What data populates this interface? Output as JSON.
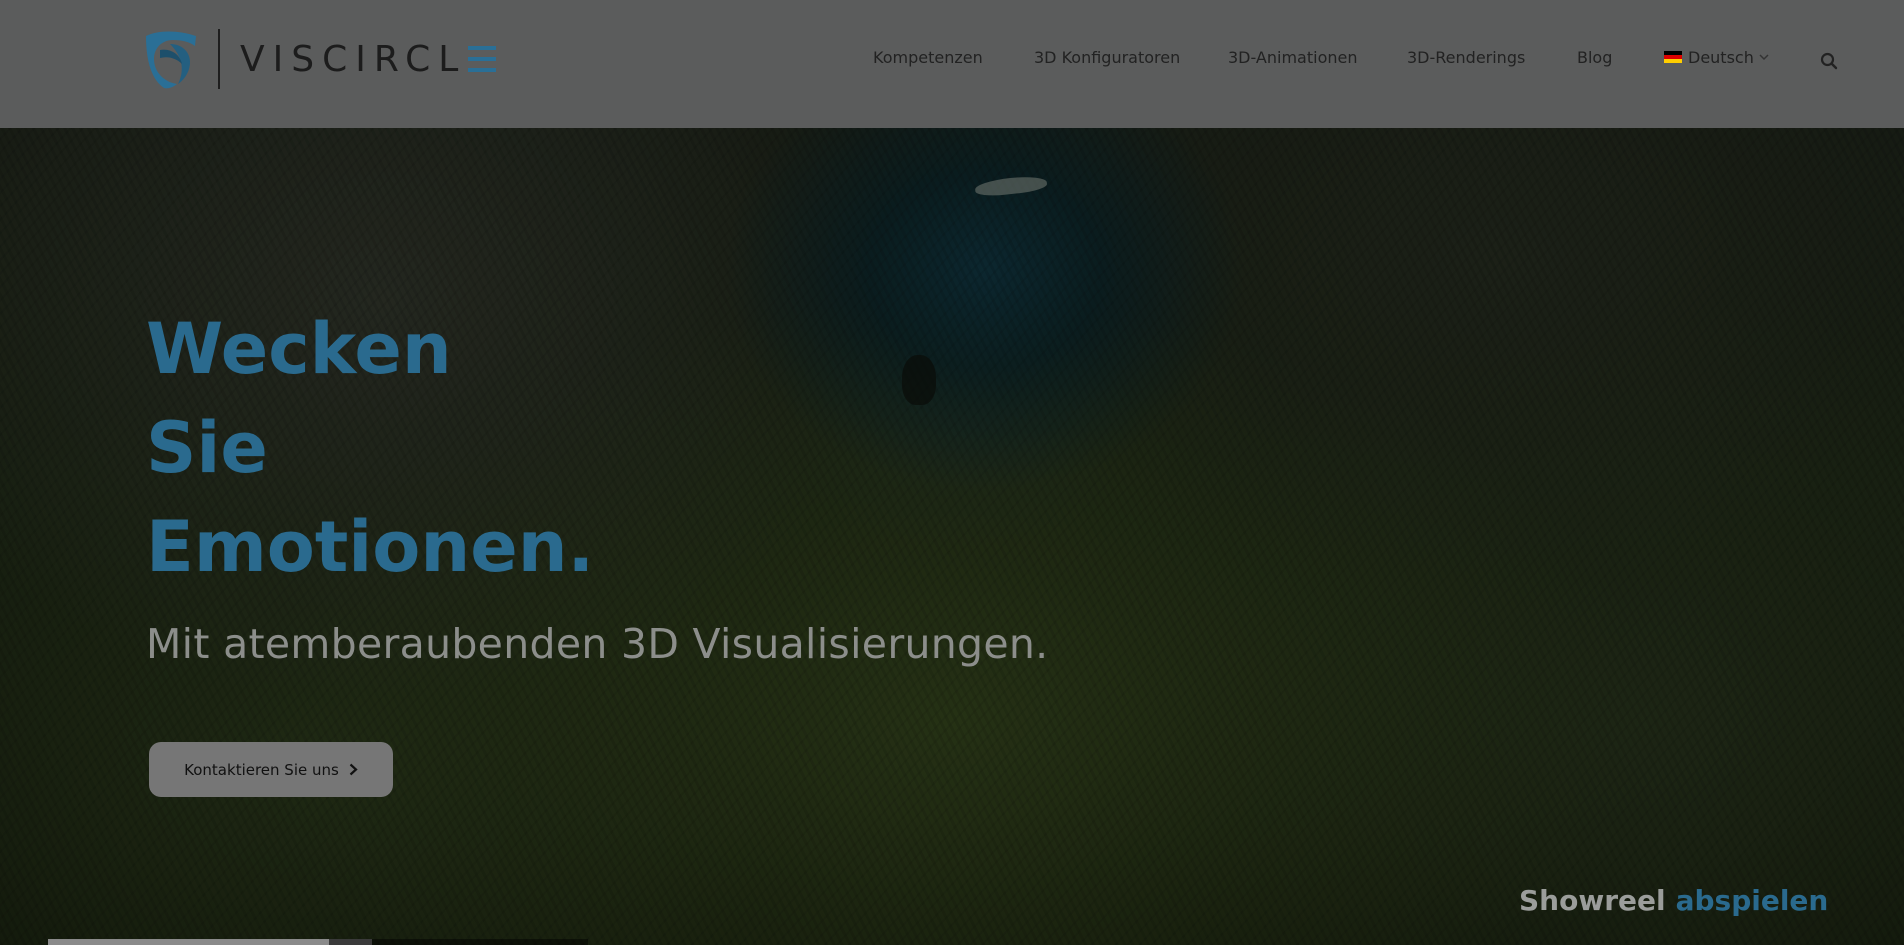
{
  "brand": {
    "name": "VISCIRCLE",
    "name_base": "VISCIRCL",
    "accent_color": "#2a6a8e",
    "logo_icon": "shield-circle-logo"
  },
  "nav": {
    "items": [
      {
        "label": "Kompetenzen"
      },
      {
        "label": "3D Konfiguratoren"
      },
      {
        "label": "3D-Animationen"
      },
      {
        "label": "3D-Renderings"
      },
      {
        "label": "Blog"
      }
    ],
    "language": {
      "label": "Deutsch",
      "flag_icon": "german-flag-icon",
      "chevron_icon": "chevron-down-icon"
    },
    "search_icon": "search-icon"
  },
  "hero": {
    "headline_lines": [
      "Wecken",
      "Sie",
      "Emotionen."
    ],
    "subline": "Mit atemberaubenden 3D Visualisierungen.",
    "cta_label": "Kontaktieren Sie uns",
    "cta_icon": "chevron-right-icon",
    "showreel_word1": "Showreel",
    "showreel_word2": "abspielen",
    "video_progress": 0.52,
    "video_buffered": 0.6
  },
  "colors": {
    "header_bg": "#5b5c5c",
    "headline": "#2a6a8e",
    "subline": "#8c8e8b",
    "cta_bg": "#767676"
  }
}
